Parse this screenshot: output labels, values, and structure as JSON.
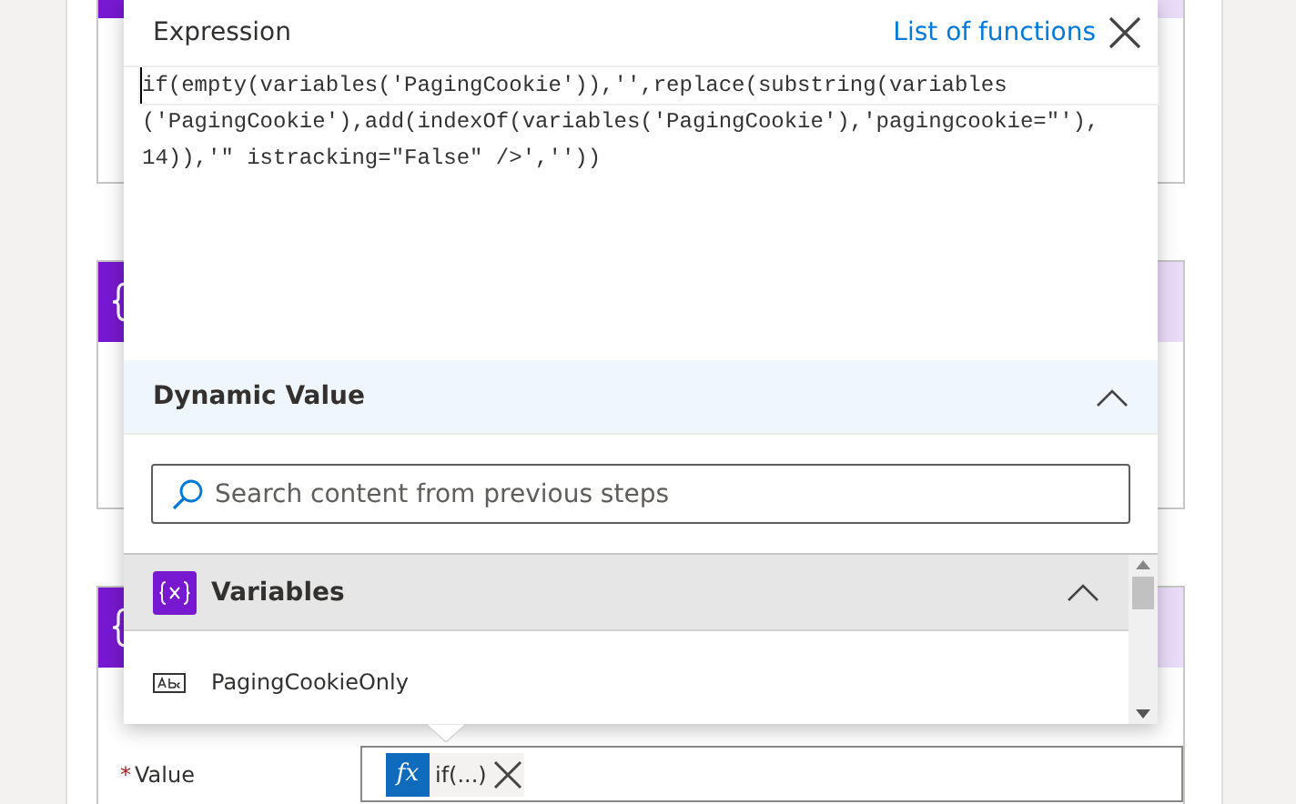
{
  "expression": {
    "title": "Expression",
    "link": "List of functions",
    "lines": [
      "if(empty(variables('PagingCookie')),'',replace(substring(variables",
      "('PagingCookie'),add(indexOf(variables('PagingCookie'),'pagingcookie=\"'),",
      "14)),'\" istracking=\"False\" />',''))"
    ]
  },
  "dynamic_value": {
    "title": "Dynamic Value",
    "expanded": true,
    "search": {
      "placeholder": "Search content from previous steps"
    },
    "groups": [
      {
        "title": "Variables",
        "expanded": true,
        "items": [
          {
            "label": "PagingCookieOnly"
          }
        ]
      }
    ]
  },
  "value_field": {
    "required_mark": "*",
    "label": "Value",
    "token": {
      "icon_text": "fx",
      "text": "if(...)"
    }
  }
}
